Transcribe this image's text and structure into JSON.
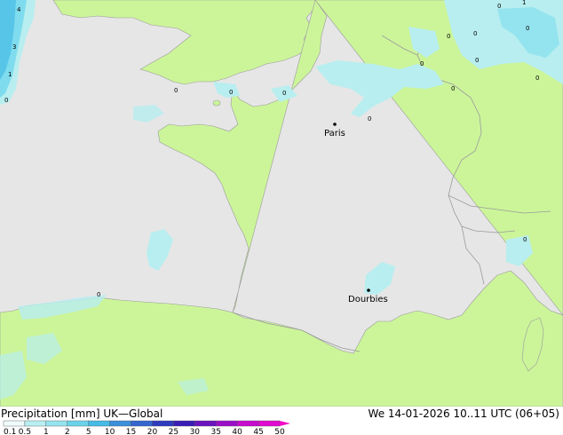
{
  "cities": [
    {
      "name": "Paris"
    },
    {
      "name": "Dourbies"
    }
  ],
  "cell_values": [
    "4",
    "3",
    "1",
    "0",
    "0",
    "0",
    "0",
    "0",
    "0",
    "0",
    "1",
    "0",
    "0",
    "0",
    "0",
    "0",
    "0",
    "0",
    "0"
  ],
  "footer": {
    "title": "Precipitation [mm]  UK—Global",
    "datetime": "We 14-01-2026 10..11 UTC (06+05)"
  },
  "legend": {
    "ticks": [
      "0.1",
      "0.5",
      "1",
      "2",
      "5",
      "10",
      "15",
      "20",
      "25",
      "30",
      "35",
      "40",
      "45",
      "50"
    ],
    "colors": [
      "#f0fbfb",
      "#b7eef2",
      "#94e4ef",
      "#6ad3ea",
      "#45bbe6",
      "#3b8fdc",
      "#3466d0",
      "#2d3bbf",
      "#3a1cb6",
      "#6a13bf",
      "#9b0ec8",
      "#c70bcf",
      "#e10ad0",
      "#f00ac6"
    ]
  },
  "colors": {
    "sea": "#e6e6e6",
    "land": "#ccf59a",
    "precip_light": "#b8eef0",
    "precip_medium": "#7fdcee",
    "border": "#9a9a9a"
  }
}
